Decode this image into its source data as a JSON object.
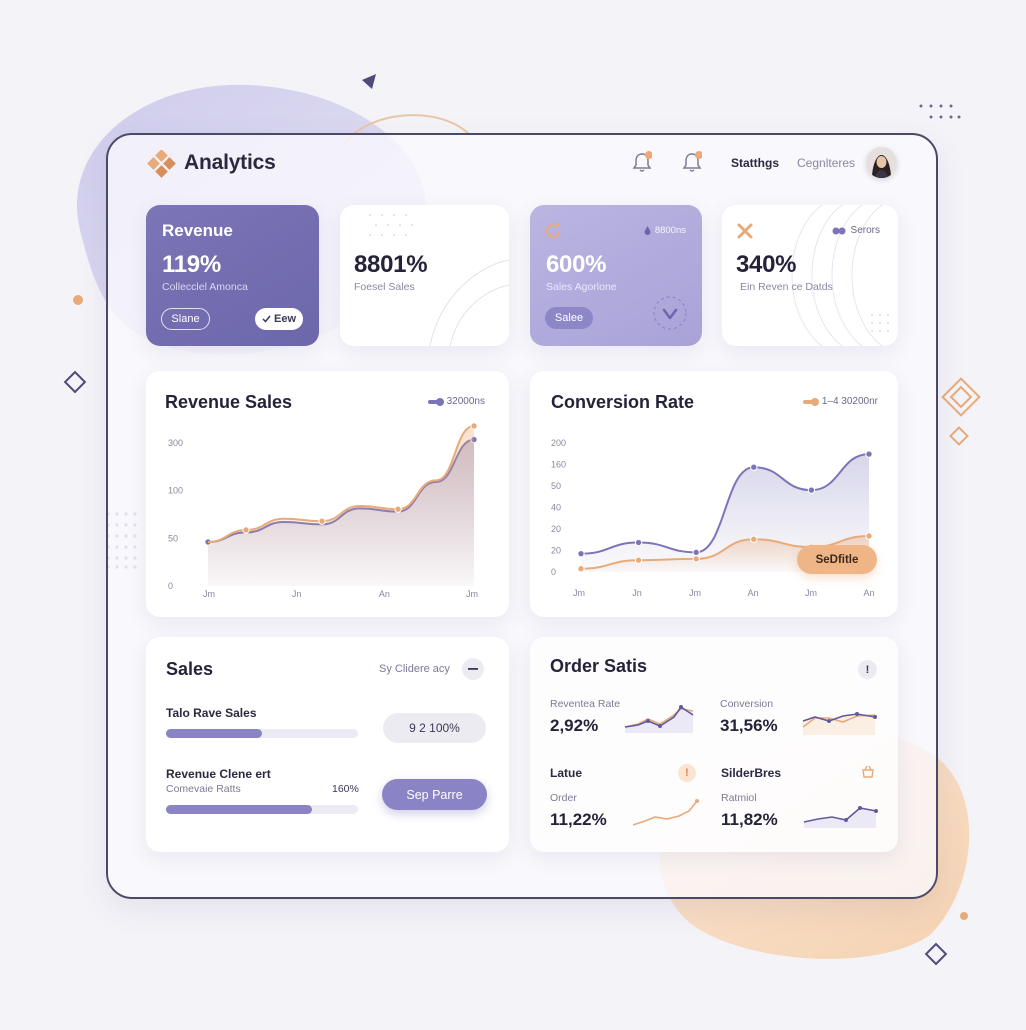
{
  "header": {
    "app_title": "Analytics",
    "links": [
      "Statthgs",
      "Cegnlteres"
    ]
  },
  "stat_cards": [
    {
      "label": "Revenue",
      "value": "119%",
      "sub": "Collecclel Amonca",
      "btn_left": "Slane",
      "btn_right": "Eew",
      "btn_right_icon": "check-icon"
    },
    {
      "value": "8801%",
      "sub": "Foesel Sales"
    },
    {
      "value": "600%",
      "sub": "Sales Agorlone",
      "badge": "8800ns",
      "btn": "Salee",
      "icon": "circle-arrow-icon",
      "check_icon": "heart-check-icon"
    },
    {
      "value": "340%",
      "sub": "Ein Reven ce Datds",
      "legend": "Serors",
      "icon": "close-x-icon"
    }
  ],
  "revenue_chart": {
    "title": "Revenue Sales",
    "legend": "32000ns"
  },
  "conversion_chart": {
    "title": "Conversion Rate",
    "legend": "1–4 30200nr",
    "button": "SeDfitle"
  },
  "sales_panel": {
    "title": "Sales",
    "filter": "Sy Clidere acy",
    "row1_title": "Talo Rave Sales",
    "row1_value": "9 2 100%",
    "row1_progress": 0.5,
    "row2_title": "Revenue Clene ert",
    "row2_sub": "Comevaie Ratts",
    "row2_pct": "160%",
    "row2_progress": 0.76,
    "button": "Sep Parre"
  },
  "order_panel": {
    "title": "Order Satis",
    "info_icon": "exclamation-icon",
    "items": [
      {
        "label": "Reventea Rate",
        "value": "2,92%"
      },
      {
        "label": "Conversion",
        "value": "31,56%"
      },
      {
        "title": "Latue",
        "label": "Order",
        "value": "11,22%"
      },
      {
        "title": "SilderBres",
        "label": "Ratmiol",
        "value": "11,82%"
      }
    ]
  },
  "chart_data": [
    {
      "type": "area",
      "title": "Revenue Sales",
      "x_ticks": [
        "Jm",
        "Jn",
        "An",
        "Jm"
      ],
      "y_ticks": [
        "0",
        "50",
        "100",
        "300"
      ],
      "series": [
        {
          "name": "32000ns",
          "color": "#7b75b8",
          "values": [
            55,
            67,
            80,
            77,
            97,
            93,
            130,
            183
          ]
        },
        {
          "color": "#e9aa79",
          "values": [
            55,
            70,
            84,
            81,
            100,
            96,
            132,
            200
          ]
        }
      ]
    },
    {
      "type": "line",
      "title": "Conversion Rate",
      "x_ticks": [
        "Jm",
        "Jn",
        "Jm",
        "An",
        "Jm",
        "An"
      ],
      "y_ticks": [
        "0",
        "20",
        "20",
        "40",
        "50",
        "160",
        "200"
      ],
      "series": [
        {
          "color": "#7b75b8",
          "values": [
            28,
            45,
            30,
            160,
            125,
            180
          ]
        },
        {
          "name": "1–4 30200nr",
          "color": "#e9aa79",
          "values": [
            5,
            18,
            20,
            50,
            38,
            55
          ]
        }
      ]
    }
  ],
  "colors": {
    "accent": "#7c76b7",
    "orange": "#e9aa79",
    "lavender": "#b3addf",
    "ink": "#25233a"
  }
}
